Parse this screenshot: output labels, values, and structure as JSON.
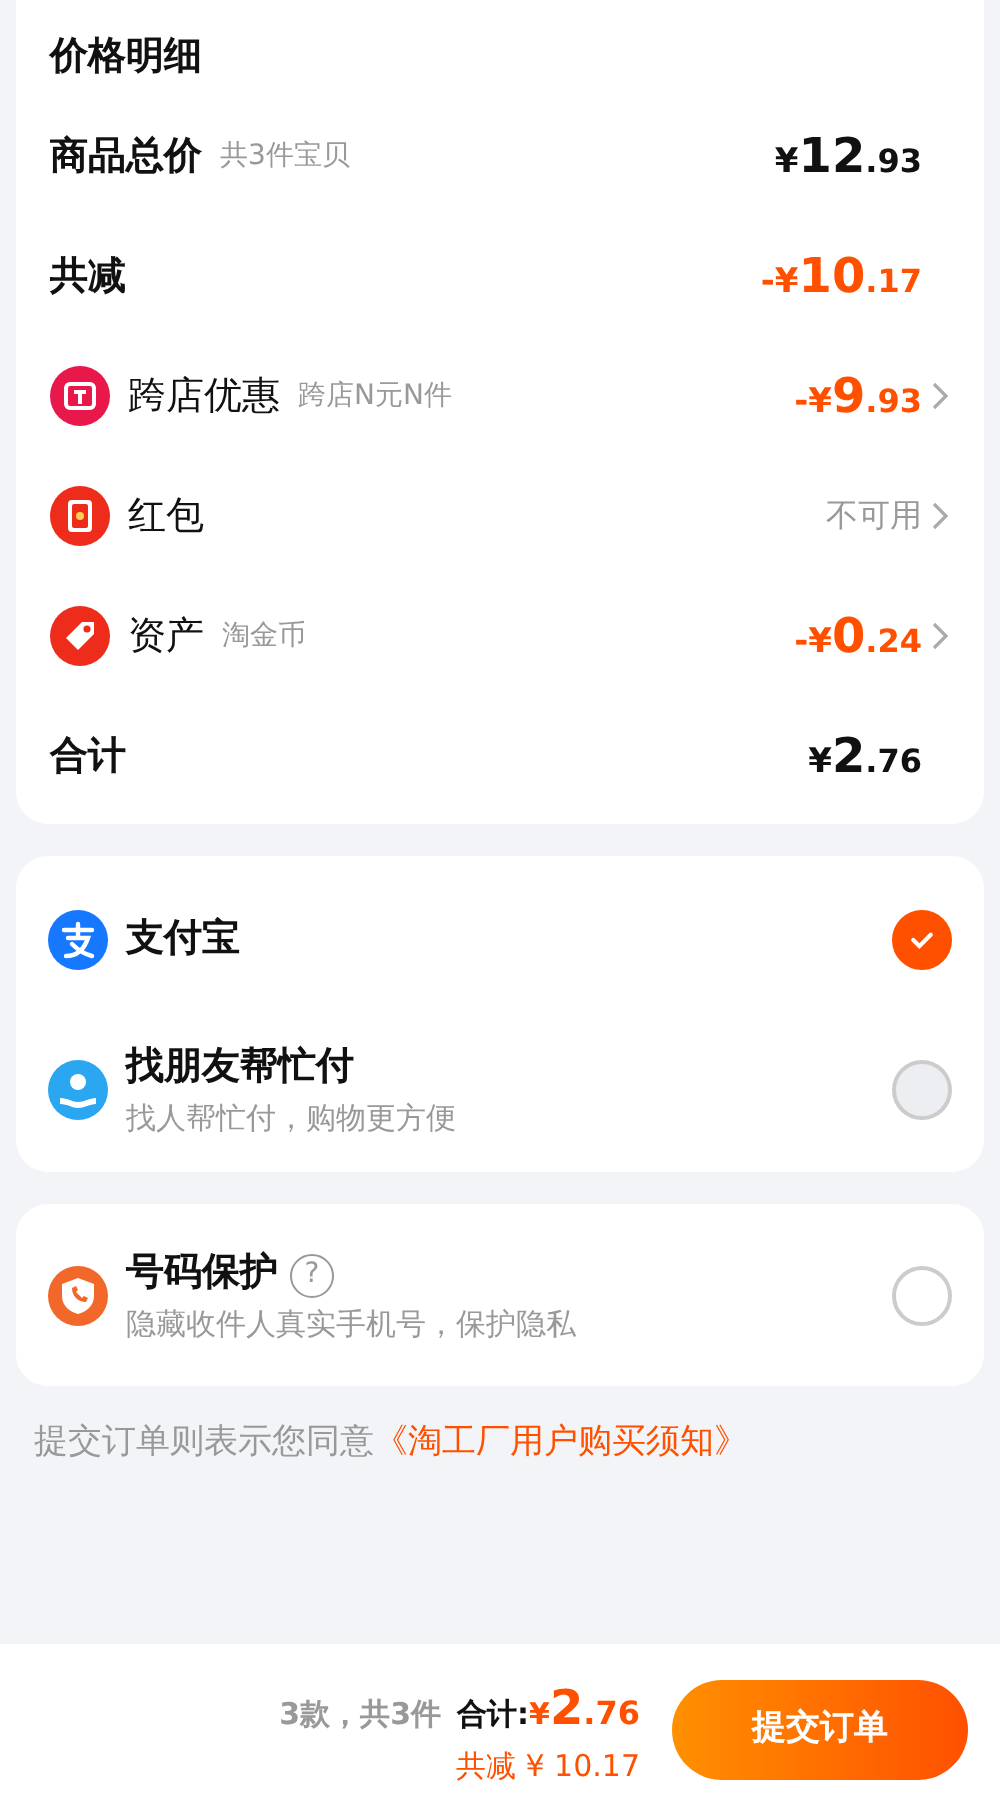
{
  "price_detail": {
    "title": "价格明细",
    "rows": [
      {
        "kind": "sum",
        "label": "商品总价",
        "note": "共3件宝贝",
        "amount": {
          "prefix": "¥",
          "main": "12",
          "fraction": ".93"
        },
        "chevron": false
      },
      {
        "kind": "reduction",
        "label": "共减",
        "amount": {
          "prefix": "-¥",
          "main": "10",
          "fraction": ".17"
        },
        "chevron": false
      },
      {
        "kind": "benefit",
        "label": "跨店优惠",
        "note": "跨店N元N件",
        "amount": {
          "prefix": "-¥",
          "main": "9",
          "fraction": ".93"
        },
        "chevron": true
      },
      {
        "kind": "benefit",
        "label": "红包",
        "status": "不可用",
        "chevron": true
      },
      {
        "kind": "benefit",
        "label": "资产",
        "note": "淘金币",
        "amount": {
          "prefix": "-¥",
          "main": "0",
          "fraction": ".24"
        },
        "chevron": true
      },
      {
        "kind": "sum",
        "label": "合计",
        "amount": {
          "prefix": "¥",
          "main": "2",
          "fraction": ".76"
        },
        "chevron": false
      }
    ]
  },
  "payment_methods": [
    {
      "label": "支付宝",
      "selected": true
    },
    {
      "label": "找朋友帮忙付",
      "sub": "找人帮忙付，购物更方便",
      "selected": false
    }
  ],
  "number_protection": {
    "label": "号码保护",
    "help": "?",
    "sub": "隐藏收件人真实手机号，保护隐私",
    "checked": false
  },
  "agreement": {
    "text": "提交订单则表示您同意",
    "link": "《淘工厂用户购买须知》"
  },
  "bottom_bar": {
    "count": "3款，共3件",
    "total_label": "合计:",
    "total": {
      "prefix": "¥",
      "main": "2",
      "fraction": ".76"
    },
    "saved": "共减 ¥ 10.17",
    "submit": "提交订单"
  }
}
